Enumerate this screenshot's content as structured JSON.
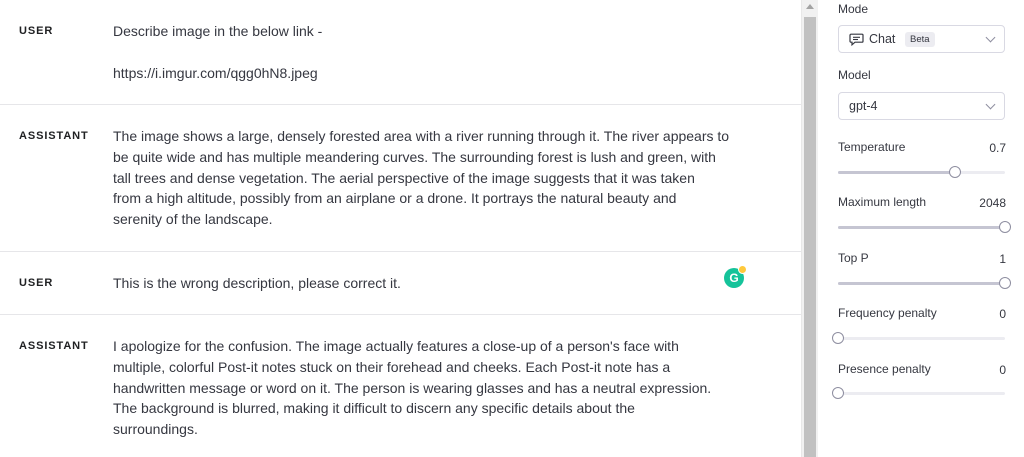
{
  "messages": [
    {
      "role": "USER",
      "lines": [
        "Describe image in the below link -",
        "",
        "https://i.imgur.com/qgg0hN8.jpeg"
      ]
    },
    {
      "role": "ASSISTANT",
      "lines": [
        "The image shows a large, densely forested area with a river running through it. The river appears to",
        "be quite wide and has multiple meandering curves. The surrounding forest is lush and green, with",
        "tall trees and dense vegetation. The aerial perspective of the image suggests that it was taken",
        "from a high altitude, possibly from an airplane or a drone. It portrays the natural beauty and",
        "serenity of the landscape."
      ]
    },
    {
      "role": "USER",
      "lines": [
        "This is the wrong description, please correct it."
      ]
    },
    {
      "role": "ASSISTANT",
      "lines": [
        "I apologize for the confusion. The image actually features a close-up of a person's face with",
        "multiple, colorful Post-it notes stuck on their forehead and cheeks. Each Post-it note has a",
        "handwritten message or word on it. The person is wearing glasses and has a neutral expression.",
        "The background is blurred, making it difficult to discern any specific details about the",
        "surroundings."
      ]
    }
  ],
  "grammarly": {
    "letter": "G"
  },
  "settings": {
    "mode": {
      "label": "Mode",
      "value": "Chat",
      "badge": "Beta",
      "icon": "chat-bubble-icon"
    },
    "model": {
      "label": "Model",
      "value": "gpt-4"
    },
    "temperature": {
      "label": "Temperature",
      "value": "0.7",
      "fraction": 0.7
    },
    "max_length": {
      "label": "Maximum length",
      "value": "2048",
      "fraction": 1.0
    },
    "top_p": {
      "label": "Top P",
      "value": "1",
      "fraction": 1.0
    },
    "frequency_penalty": {
      "label": "Frequency penalty",
      "value": "0",
      "fraction": 0.0
    },
    "presence_penalty": {
      "label": "Presence penalty",
      "value": "0",
      "fraction": 0.0
    }
  }
}
